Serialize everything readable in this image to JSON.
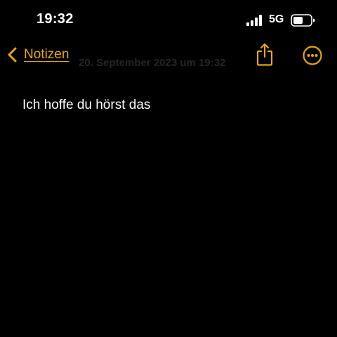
{
  "status_bar": {
    "time": "19:32",
    "signal_icon": "cellular-signal-icon",
    "network": "5G",
    "battery_icon": "battery-icon"
  },
  "nav": {
    "back_icon": "chevron-left-icon",
    "back_label": "Notizen",
    "date": "20. September 2023 um 19:32",
    "share_icon": "share-icon",
    "more_icon": "ellipsis-circle-icon"
  },
  "note": {
    "text": "Ich hoffe du hörst das"
  },
  "colors": {
    "background": "#000000",
    "accent": "#E6A80A",
    "text": "#FFFFFF",
    "date_text": "#262626"
  }
}
